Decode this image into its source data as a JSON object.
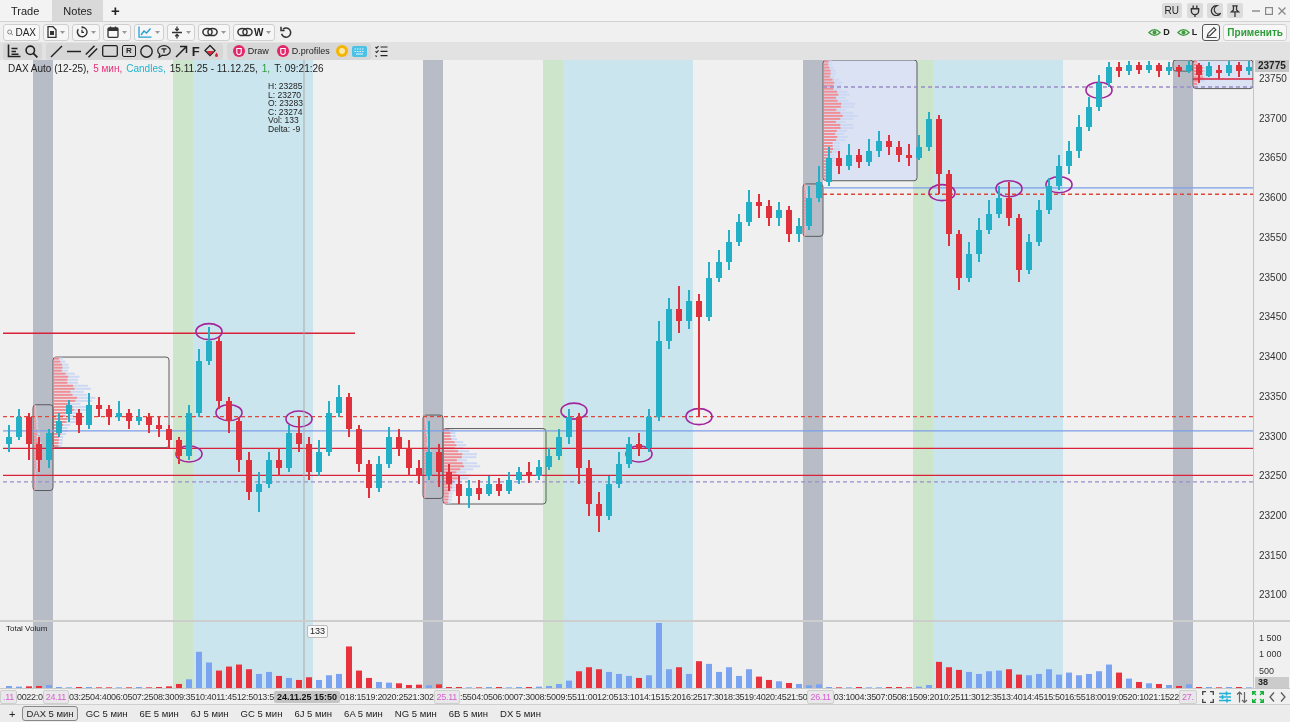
{
  "title_bar": {
    "tabs": [
      {
        "label": "Trade",
        "selected": false
      },
      {
        "label": "Notes",
        "selected": true
      }
    ],
    "add_tab": "+",
    "language": "RU"
  },
  "toolbar": {
    "symbol_search": {
      "value": "DAX"
    },
    "link_group": "W",
    "layers": [
      {
        "label": "D",
        "visible": true
      },
      {
        "label": "L",
        "visible": true
      }
    ],
    "pen_tool": {
      "active": true
    },
    "apply_button": "Применить"
  },
  "drawing_toolbar": {
    "box_label_tool": "R",
    "letter_tool": "F",
    "draw_toggle": "Draw",
    "profiles_toggle": "D.profiles"
  },
  "chart": {
    "legend": [
      {
        "kind": "instrument",
        "text": "DAX Auto (12-25),"
      },
      {
        "kind": "timeframe",
        "text": "5 мин,"
      },
      {
        "kind": "style",
        "text": "Candles,"
      },
      {
        "kind": "range",
        "text": "15.11.25 - 11.12.25,"
      },
      {
        "kind": "count",
        "text": "1,"
      },
      {
        "kind": "clock",
        "text": "T: 09:21:26"
      }
    ],
    "readout": [
      "H: 23285",
      "L: 23270",
      "O: 23283",
      "C: 23274",
      "Vol: 133",
      "Delta: -9"
    ],
    "last_price": "23775",
    "volume_title": "Total Volum",
    "volume_last": "38",
    "cursor_volume_label": "133",
    "chart_data": [
      {
        "type": "candlestick",
        "ylim": [
          23069,
          23774
        ],
        "yticks": [
          23100,
          23150,
          23200,
          23250,
          23300,
          23350,
          23400,
          23450,
          23500,
          23550,
          23600,
          23650,
          23700,
          23750
        ],
        "tick_labels": "y",
        "ohlc": [
          [
            23290,
            23315,
            23280,
            23300
          ],
          [
            23300,
            23335,
            23295,
            23325
          ],
          [
            23325,
            23330,
            23270,
            23290
          ],
          [
            23290,
            23300,
            23255,
            23270
          ],
          [
            23270,
            23310,
            23260,
            23305
          ],
          [
            23305,
            23330,
            23300,
            23320
          ],
          [
            23328,
            23346,
            23318,
            23340
          ],
          [
            23330,
            23335,
            23305,
            23315
          ],
          [
            23315,
            23355,
            23310,
            23340
          ],
          [
            23340,
            23350,
            23325,
            23335
          ],
          [
            23335,
            23340,
            23315,
            23325
          ],
          [
            23325,
            23345,
            23320,
            23330
          ],
          [
            23330,
            23335,
            23310,
            23320
          ],
          [
            23320,
            23335,
            23315,
            23325
          ],
          [
            23325,
            23330,
            23305,
            23315
          ],
          [
            23315,
            23325,
            23300,
            23310
          ],
          [
            23310,
            23315,
            23285,
            23295
          ],
          [
            23295,
            23300,
            23265,
            23275
          ],
          [
            23275,
            23340,
            23270,
            23330
          ],
          [
            23330,
            23410,
            23325,
            23395
          ],
          [
            23395,
            23438,
            23390,
            23420
          ],
          [
            23420,
            23425,
            23335,
            23345
          ],
          [
            23345,
            23350,
            23305,
            23320
          ],
          [
            23320,
            23325,
            23255,
            23270
          ],
          [
            23270,
            23280,
            23220,
            23230
          ],
          [
            23230,
            23255,
            23205,
            23240
          ],
          [
            23240,
            23280,
            23235,
            23270
          ],
          [
            23270,
            23285,
            23250,
            23260
          ],
          [
            23260,
            23315,
            23255,
            23305
          ],
          [
            23305,
            23325,
            23280,
            23290
          ],
          [
            23290,
            23300,
            23245,
            23255
          ],
          [
            23255,
            23295,
            23250,
            23280
          ],
          [
            23280,
            23345,
            23275,
            23330
          ],
          [
            23330,
            23365,
            23325,
            23350
          ],
          [
            23350,
            23355,
            23300,
            23310
          ],
          [
            23310,
            23315,
            23255,
            23265
          ],
          [
            23265,
            23270,
            23222,
            23235
          ],
          [
            23235,
            23275,
            23230,
            23265
          ],
          [
            23265,
            23312,
            23260,
            23300
          ],
          [
            23300,
            23310,
            23275,
            23285
          ],
          [
            23285,
            23295,
            23250,
            23260
          ],
          [
            23260,
            23270,
            23240,
            23250
          ],
          [
            23250,
            23320,
            23245,
            23280
          ],
          [
            23280,
            23290,
            23236,
            23255
          ],
          [
            23255,
            23265,
            23232,
            23240
          ],
          [
            23240,
            23250,
            23215,
            23225
          ],
          [
            23225,
            23245,
            23210,
            23235
          ],
          [
            23235,
            23245,
            23220,
            23228
          ],
          [
            23228,
            23250,
            23225,
            23240
          ],
          [
            23240,
            23248,
            23225,
            23232
          ],
          [
            23232,
            23255,
            23228,
            23245
          ],
          [
            23245,
            23262,
            23240,
            23255
          ],
          [
            23255,
            23268,
            23242,
            23250
          ],
          [
            23250,
            23270,
            23245,
            23262
          ],
          [
            23262,
            23285,
            23258,
            23275
          ],
          [
            23275,
            23310,
            23270,
            23300
          ],
          [
            23300,
            23335,
            23290,
            23325
          ],
          [
            23325,
            23330,
            23240,
            23260
          ],
          [
            23260,
            23270,
            23200,
            23215
          ],
          [
            23215,
            23230,
            23180,
            23200
          ],
          [
            23200,
            23250,
            23195,
            23240
          ],
          [
            23240,
            23280,
            23235,
            23265
          ],
          [
            23265,
            23300,
            23260,
            23290
          ],
          [
            23290,
            23305,
            23275,
            23285
          ],
          [
            23285,
            23335,
            23280,
            23325
          ],
          [
            23325,
            23445,
            23320,
            23420
          ],
          [
            23420,
            23475,
            23410,
            23460
          ],
          [
            23460,
            23490,
            23430,
            23445
          ],
          [
            23445,
            23485,
            23435,
            23470
          ],
          [
            23470,
            23480,
            23325,
            23450
          ],
          [
            23450,
            23520,
            23445,
            23500
          ],
          [
            23500,
            23535,
            23495,
            23520
          ],
          [
            23520,
            23560,
            23510,
            23545
          ],
          [
            23545,
            23580,
            23540,
            23570
          ],
          [
            23570,
            23610,
            23565,
            23595
          ],
          [
            23595,
            23605,
            23575,
            23590
          ],
          [
            23590,
            23598,
            23565,
            23575
          ],
          [
            23575,
            23595,
            23565,
            23585
          ],
          [
            23585,
            23590,
            23545,
            23555
          ],
          [
            23555,
            23575,
            23545,
            23565
          ],
          [
            23565,
            23615,
            23560,
            23600
          ],
          [
            23600,
            23640,
            23595,
            23620
          ],
          [
            23620,
            23665,
            23615,
            23650
          ],
          [
            23650,
            23660,
            23630,
            23640
          ],
          [
            23640,
            23668,
            23635,
            23655
          ],
          [
            23655,
            23662,
            23638,
            23645
          ],
          [
            23645,
            23675,
            23640,
            23660
          ],
          [
            23660,
            23685,
            23652,
            23672
          ],
          [
            23672,
            23680,
            23655,
            23665
          ],
          [
            23665,
            23672,
            23645,
            23655
          ],
          [
            23655,
            23668,
            23640,
            23650
          ],
          [
            23650,
            23680,
            23648,
            23665
          ],
          [
            23665,
            23708,
            23660,
            23700
          ],
          [
            23700,
            23705,
            23605,
            23630
          ],
          [
            23630,
            23635,
            23540,
            23555
          ],
          [
            23555,
            23560,
            23485,
            23500
          ],
          [
            23500,
            23545,
            23495,
            23530
          ],
          [
            23530,
            23575,
            23520,
            23560
          ],
          [
            23560,
            23598,
            23555,
            23580
          ],
          [
            23580,
            23615,
            23575,
            23600
          ],
          [
            23600,
            23620,
            23565,
            23575
          ],
          [
            23575,
            23580,
            23495,
            23510
          ],
          [
            23510,
            23555,
            23505,
            23545
          ],
          [
            23545,
            23598,
            23540,
            23585
          ],
          [
            23585,
            23625,
            23580,
            23615
          ],
          [
            23615,
            23655,
            23610,
            23640
          ],
          [
            23640,
            23672,
            23630,
            23660
          ],
          [
            23660,
            23705,
            23650,
            23690
          ],
          [
            23690,
            23728,
            23685,
            23715
          ],
          [
            23715,
            23755,
            23710,
            23745
          ],
          [
            23745,
            23772,
            23740,
            23765
          ],
          [
            23765,
            23772,
            23752,
            23760
          ],
          [
            23760,
            23773,
            23755,
            23768
          ],
          [
            23768,
            23772,
            23756,
            23762
          ],
          [
            23762,
            23773,
            23758,
            23768
          ],
          [
            23768,
            23770,
            23752,
            23760
          ],
          [
            23760,
            23772,
            23755,
            23765
          ],
          [
            23765,
            23768,
            23752,
            23760
          ],
          [
            23760,
            23773,
            23758,
            23768
          ],
          [
            23768,
            23770,
            23745,
            23755
          ],
          [
            23754,
            23771,
            23752,
            23766
          ],
          [
            23762,
            23768,
            23750,
            23758
          ],
          [
            23758,
            23773,
            23754,
            23768
          ],
          [
            23768,
            23772,
            23753,
            23760
          ],
          [
            23760,
            23773,
            23755,
            23765
          ]
        ],
        "ref_lines": [
          {
            "axis": "y",
            "value": 23325,
            "color": "#e0473a",
            "line_style": "dashed"
          },
          {
            "axis": "y",
            "value": 23307,
            "color": "#7b9ee8",
            "line_style": "solid"
          },
          {
            "axis": "y",
            "value": 23285,
            "color": "#d9213a",
            "line_style": "solid"
          },
          {
            "axis": "y",
            "value": 23251,
            "color": "#d9213a",
            "line_style": "solid"
          },
          {
            "axis": "y",
            "value": 23243,
            "color": "#9a8cc8",
            "line_style": "dashed"
          }
        ]
      },
      {
        "type": "bar",
        "ylim": [
          0,
          1970
        ],
        "yticks": [
          {
            "value": 500,
            "label": "500"
          },
          {
            "value": 1000,
            "label": "1 000"
          },
          {
            "value": 1500,
            "label": "1 500"
          }
        ],
        "tick_labels": "y",
        "values": [
          60,
          40,
          50,
          60,
          90,
          30,
          20,
          30,
          30,
          20,
          20,
          20,
          20,
          30,
          20,
          30,
          50,
          120,
          260,
          1080,
          760,
          520,
          640,
          700,
          560,
          420,
          480,
          360,
          300,
          240,
          320,
          240,
          380,
          420,
          1240,
          520,
          300,
          180,
          160,
          140,
          90,
          100,
          80,
          110,
          30,
          30,
          20,
          20,
          30,
          30,
          20,
          30,
          30,
          40,
          60,
          120,
          220,
          500,
          620,
          560,
          480,
          420,
          360,
          300,
          380,
          1940,
          560,
          620,
          420,
          800,
          720,
          480,
          620,
          360,
          560,
          340,
          240,
          200,
          150,
          120,
          80,
          110,
          30,
          20,
          20,
          30,
          20,
          20,
          30,
          30,
          20,
          40,
          90,
          780,
          620,
          540,
          480,
          420,
          500,
          520,
          560,
          400,
          380,
          420,
          560,
          400,
          460,
          380,
          420,
          500,
          700,
          460,
          280,
          180,
          140,
          120,
          90,
          60,
          110,
          30,
          30,
          20,
          30,
          30,
          20
        ]
      }
    ],
    "time_axis": [
      {
        "kind": "date",
        "text": ".11"
      },
      {
        "kind": "time",
        "text": "0022:0"
      },
      {
        "kind": "date",
        "text": "24.11"
      },
      {
        "kind": "time",
        "text": "03:25"
      },
      {
        "kind": "time",
        "text": "04:40"
      },
      {
        "kind": "time",
        "text": "06:05"
      },
      {
        "kind": "time",
        "text": "07:25"
      },
      {
        "kind": "time",
        "text": "08:30"
      },
      {
        "kind": "time",
        "text": "09:35"
      },
      {
        "kind": "time",
        "text": "10:40"
      },
      {
        "kind": "time",
        "text": "11:45"
      },
      {
        "kind": "time",
        "text": "12:50"
      },
      {
        "kind": "time",
        "text": "13:5"
      },
      {
        "kind": "cursor",
        "text": "24.11.25 15:50"
      },
      {
        "kind": "time",
        "text": "0"
      },
      {
        "kind": "time",
        "text": "18:15"
      },
      {
        "kind": "time",
        "text": "19:20"
      },
      {
        "kind": "time",
        "text": "20:25"
      },
      {
        "kind": "time",
        "text": "21:30"
      },
      {
        "kind": "time",
        "text": "2"
      },
      {
        "kind": "date",
        "text": "25.11"
      },
      {
        "kind": "time",
        "text": ":55"
      },
      {
        "kind": "time",
        "text": "04:05"
      },
      {
        "kind": "time",
        "text": "06:00"
      },
      {
        "kind": "time",
        "text": "07:30"
      },
      {
        "kind": "time",
        "text": "08:50"
      },
      {
        "kind": "time",
        "text": "09:55"
      },
      {
        "kind": "time",
        "text": "11:00"
      },
      {
        "kind": "time",
        "text": "12:05"
      },
      {
        "kind": "time",
        "text": "13:10"
      },
      {
        "kind": "time",
        "text": "14:15"
      },
      {
        "kind": "time",
        "text": "15:20"
      },
      {
        "kind": "time",
        "text": "16:25"
      },
      {
        "kind": "time",
        "text": "17:30"
      },
      {
        "kind": "time",
        "text": "18:35"
      },
      {
        "kind": "time",
        "text": "19:40"
      },
      {
        "kind": "time",
        "text": "20:45"
      },
      {
        "kind": "time",
        "text": "21:50"
      },
      {
        "kind": "date",
        "text": "26.11"
      },
      {
        "kind": "time",
        "text": "03:10"
      },
      {
        "kind": "time",
        "text": "04:35"
      },
      {
        "kind": "time",
        "text": "07:05"
      },
      {
        "kind": "time",
        "text": "08:15"
      },
      {
        "kind": "time",
        "text": "09:20"
      },
      {
        "kind": "time",
        "text": "10:25"
      },
      {
        "kind": "time",
        "text": "11:30"
      },
      {
        "kind": "time",
        "text": "12:35"
      },
      {
        "kind": "time",
        "text": "13:40"
      },
      {
        "kind": "time",
        "text": "14:45"
      },
      {
        "kind": "time",
        "text": "15:50"
      },
      {
        "kind": "time",
        "text": "16:55"
      },
      {
        "kind": "time",
        "text": "18:00"
      },
      {
        "kind": "time",
        "text": "19:05"
      },
      {
        "kind": "time",
        "text": "20:10"
      },
      {
        "kind": "time",
        "text": "21:15"
      },
      {
        "kind": "time",
        "text": "22"
      },
      {
        "kind": "date",
        "text": "27."
      }
    ]
  },
  "instrument_tabs": {
    "add": "+",
    "tabs": [
      {
        "label": "DAX 5 мин",
        "selected": true
      },
      {
        "label": "GC 5 мин",
        "selected": false
      },
      {
        "label": "6E 5 мин",
        "selected": false
      },
      {
        "label": "6J 5 мин",
        "selected": false
      },
      {
        "label": "GC 5 мин",
        "selected": false
      },
      {
        "label": "6J 5 мин",
        "selected": false
      },
      {
        "label": "6A 5 мин",
        "selected": false
      },
      {
        "label": "NG 5 мин",
        "selected": false
      },
      {
        "label": "6B 5 мин",
        "selected": false
      },
      {
        "label": "DX 5 мин",
        "selected": false
      }
    ]
  }
}
